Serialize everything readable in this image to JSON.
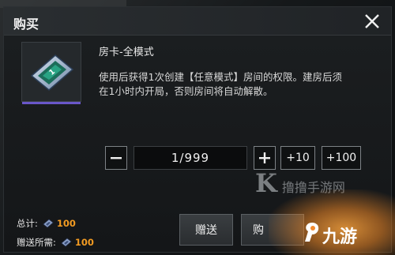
{
  "dialog": {
    "title": "购买",
    "close_icon": "close-icon"
  },
  "item": {
    "name": "房卡-全模式",
    "description": "使用后获得1次创建【任意模式】房间的权限。建房后须在1小时内开局，否则房间将自动解散。",
    "icon": "room-card-icon",
    "accent_color": "#6a57c9"
  },
  "quantity": {
    "minus_icon": "minus-icon",
    "value": "1/999",
    "plus_icon": "plus-icon",
    "plus10_label": "+10",
    "plus100_label": "+100"
  },
  "totals": {
    "total_label": "总计:",
    "total_amount": "100",
    "gift_label": "赠送所需:",
    "gift_amount": "100",
    "currency_icon": "room-card-mini-icon",
    "amount_color": "#f29b22"
  },
  "actions": {
    "gift_label": "赠送",
    "buy_label": "购"
  },
  "watermarks": {
    "site1": "撸撸手游网",
    "site1_mark": "K",
    "site2": "九游"
  }
}
